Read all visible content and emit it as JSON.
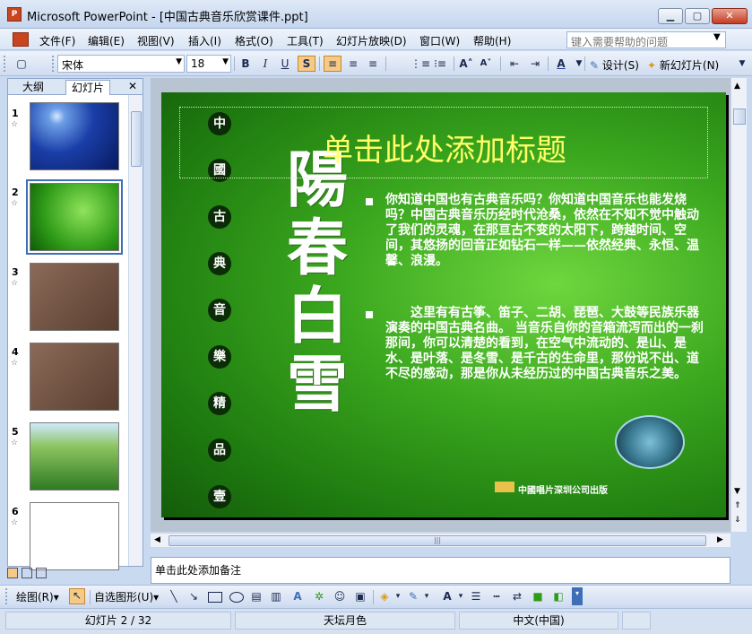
{
  "window": {
    "app_icon": "P",
    "title": "Microsoft PowerPoint - [中国古典音乐欣赏课件.ppt]",
    "minimize": "▁",
    "maximize": "▢",
    "close": "✕"
  },
  "menu": {
    "items": [
      "文件(F)",
      "编辑(E)",
      "视图(V)",
      "插入(I)",
      "格式(O)",
      "工具(T)",
      "幻灯片放映(D)",
      "窗口(W)",
      "帮助(H)"
    ],
    "help_placeholder": "键入需要帮助的问题",
    "help_arrow": "▼"
  },
  "format_toolbar": {
    "font_name": "宋体",
    "font_size": "18",
    "dd": "▼",
    "bold": "B",
    "italic": "I",
    "underline": "U",
    "shadow": "S",
    "align_left": "≡",
    "align_center": "≡",
    "align_right": "≡",
    "numbering": "⋮≡",
    "bullets": "⁝≡",
    "grow_font": "A˄",
    "shrink_font": "A˅",
    "decrease_indent": "⇤",
    "increase_indent": "⇥",
    "font_color": "A",
    "design_label": "设计(S)",
    "new_slide_label": "新幻灯片(N)"
  },
  "left_pane": {
    "tab_outline": "大纲",
    "tab_slides": "幻灯片",
    "close": "✕",
    "slides": [
      {
        "num": "1"
      },
      {
        "num": "2"
      },
      {
        "num": "3"
      },
      {
        "num": "4"
      },
      {
        "num": "5"
      },
      {
        "num": "6"
      }
    ],
    "star": "☆"
  },
  "slide": {
    "title_placeholder": "单击此处添加标题",
    "vertical_chars": [
      "中",
      "國",
      "古",
      "典",
      "音",
      "樂",
      "精",
      "品",
      "壹"
    ],
    "big_title": "陽春白雪",
    "paragraph1": "你知道中国也有古典音乐吗？你知道中国音乐也能发烧吗？中国古典音乐历经时代沧桑，依然在不知不觉中触动了我们的灵魂，在那亘古不变的太阳下，跨越时间、空间，其悠扬的回音正如钻石一样——依然经典、永恒、温馨、浪漫。",
    "paragraph2": "　　这里有有古筝、笛子、二胡、琵琶、大鼓等民族乐器演奏的中国古典名曲。 当音乐自你的音箱流泻而出的一刹那间，你可以清楚的看到，在空气中流动的、是山、是水、是叶落、是冬雪、是千古的生命里，那份说不出、道不尽的感动，那是你从未经历过的中国古典音乐之美。",
    "publisher": "中國唱片深圳公司出版"
  },
  "notes_placeholder": "单击此处添加备注",
  "scroll": {
    "up": "▲",
    "down": "▼",
    "left": "◀",
    "right": "▶",
    "prev_slide": "⇑",
    "next_slide": "⇓",
    "grip": "|||"
  },
  "draw_toolbar": {
    "draw_label": "绘图(R)",
    "autoshapes_label": "自选图形(U)",
    "arrow": "▾",
    "select_icon": "↖"
  },
  "status": {
    "slide_info": "幻灯片 2 / 32",
    "design": "天坛月色",
    "language": "中文(中国)"
  }
}
